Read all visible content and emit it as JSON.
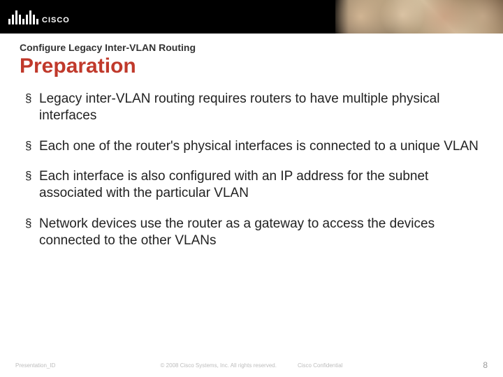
{
  "header": {
    "logo_text": "CISCO"
  },
  "slide": {
    "subtitle": "Configure Legacy Inter-VLAN Routing",
    "title": "Preparation",
    "bullets": [
      "Legacy inter-VLAN routing requires routers to have multiple physical interfaces",
      "Each one of the router's physical interfaces is connected to a unique VLAN",
      "Each interface is also configured with an IP address for the subnet associated with the particular VLAN",
      "Network devices use the router as a gateway to access the devices connected to the other VLANs"
    ]
  },
  "footer": {
    "presentation_id": "Presentation_ID",
    "copyright": "© 2008 Cisco Systems, Inc. All rights reserved.",
    "confidential": "Cisco Confidential",
    "page": "8"
  }
}
